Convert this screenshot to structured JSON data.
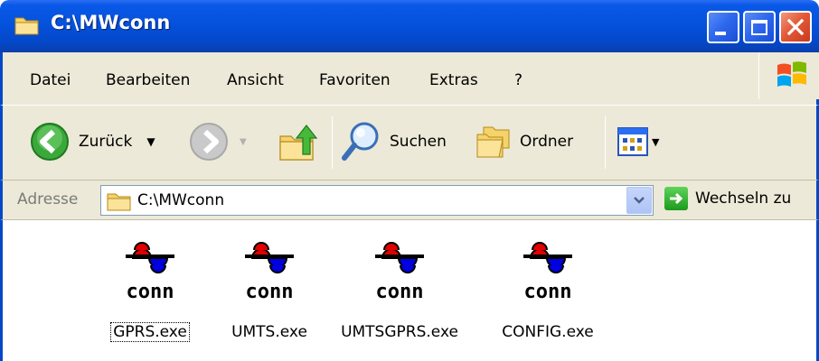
{
  "window": {
    "title": "C:\\MWconn"
  },
  "menu": {
    "items": [
      {
        "label": "Datei"
      },
      {
        "label": "Bearbeiten"
      },
      {
        "label": "Ansicht"
      },
      {
        "label": "Favoriten"
      },
      {
        "label": "Extras"
      },
      {
        "label": "?"
      }
    ]
  },
  "toolbar": {
    "back_label": "Zurück",
    "search_label": "Suchen",
    "folders_label": "Ordner"
  },
  "address": {
    "label": "Adresse",
    "value": "C:\\MWconn",
    "go_label": "Wechseln zu"
  },
  "files": [
    {
      "name": "GPRS.exe",
      "icon": "mwconn-app-icon",
      "focused": true
    },
    {
      "name": "UMTS.exe",
      "icon": "mwconn-app-icon",
      "focused": false
    },
    {
      "name": "UMTSGPRS.exe",
      "icon": "mwconn-app-icon",
      "focused": false
    },
    {
      "name": "CONFIG.exe",
      "icon": "mwconn-app-icon",
      "focused": false
    }
  ],
  "colors": {
    "titlebar": "#0552dc",
    "chrome": "#ece9d8",
    "close_button": "#e35a38",
    "icon_red": "#e00000",
    "icon_blue": "#0000e0"
  }
}
